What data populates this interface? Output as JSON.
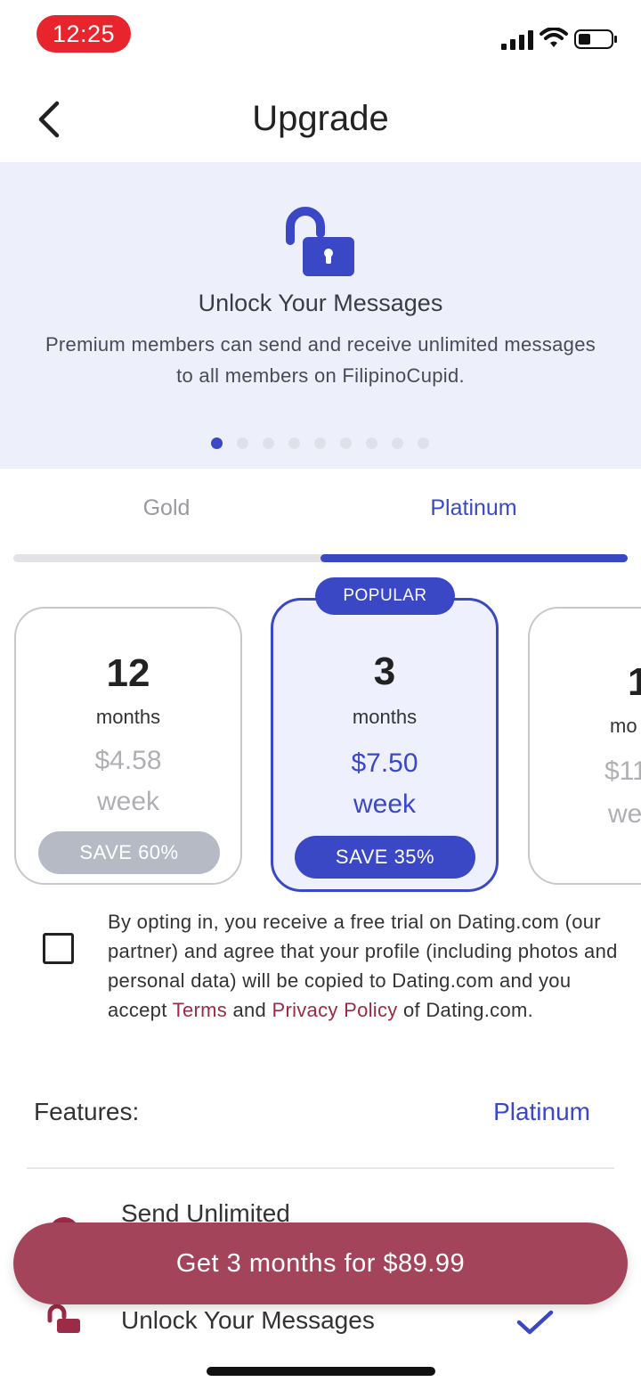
{
  "status_bar": {
    "time": "12:25"
  },
  "header": {
    "title": "Upgrade",
    "back_icon": "chevron-left-icon"
  },
  "carousel": {
    "icon": "unlocked-padlock-icon",
    "title": "Unlock Your Messages",
    "description": "Premium members can send and receive unlimited messages to all members on FilipinoCupid.",
    "slide_count": 9,
    "active_slide": 1
  },
  "tabs": [
    {
      "label": "Gold",
      "selected": false
    },
    {
      "label": "Platinum",
      "selected": true
    }
  ],
  "plans": [
    {
      "duration": "12",
      "unit": "months",
      "price": "$4.58",
      "per": "week",
      "save": "SAVE 60%",
      "selected": false
    },
    {
      "duration": "3",
      "unit": "months",
      "price": "$7.50",
      "per": "week",
      "save": "SAVE 35%",
      "selected": true,
      "badge": "POPULAR"
    },
    {
      "duration": "1",
      "unit": "mo",
      "price": "$11.",
      "per": "we",
      "selected": false
    }
  ],
  "optin": {
    "checked": false,
    "text_before": "By opting in, you receive a free trial on Dating.com (our partner) and agree that your profile (including photos and personal data) will be copied to Dating.com and you accept ",
    "terms_link": "Terms",
    "text_and": " and ",
    "privacy_link": "Privacy Policy",
    "text_after": " of Dating.com."
  },
  "features": {
    "label": "Features:",
    "plan_label": "Platinum",
    "items": [
      {
        "label": "Send Unlimited",
        "icon": "feature-icon"
      },
      {
        "label": "Unlock Your Messages",
        "icon": "unlocked-padlock-icon",
        "included_icon": "checkmark-icon"
      }
    ]
  },
  "cta": {
    "label": "Get 3 months for $89.99"
  },
  "colors": {
    "accent": "#3a48c6",
    "cta": "#a4445a",
    "link": "#9c2b47",
    "carousel_bg": "#edf0fb"
  }
}
